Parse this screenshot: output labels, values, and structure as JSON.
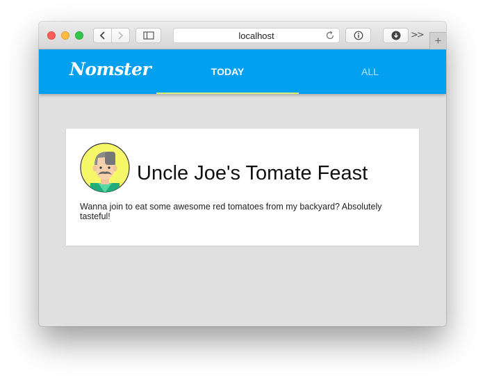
{
  "browser": {
    "address": "localhost",
    "icons": {
      "back": "chevron-left-icon",
      "forward": "chevron-right-icon",
      "sidebar": "sidebar-icon",
      "reload": "reload-icon",
      "info": "info-icon",
      "download": "download-icon",
      "overflow": "double-chevron-right-icon",
      "new_tab": "plus-icon"
    },
    "overflow_label": ">>",
    "new_tab_label": "+"
  },
  "app": {
    "logo": "Nomster",
    "accent_color": "#03a0ef",
    "indicator_color": "#d8f07a",
    "tabs": [
      {
        "label": "TODAY",
        "active": true
      },
      {
        "label": "ALL",
        "active": false
      }
    ]
  },
  "card": {
    "title": "Uncle Joe's Tomate Feast",
    "description": "Wanna join to eat some awesome red tomatoes from my backyard? Absolutely tasteful!",
    "avatar": "man-mustache-avatar"
  }
}
